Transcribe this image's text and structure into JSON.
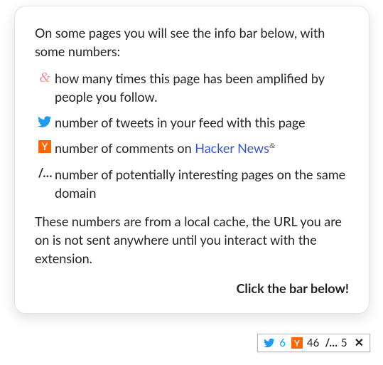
{
  "card": {
    "intro": "On some pages you will see the info bar below, with some numbers:",
    "legend": {
      "amp": "how many times this page has been amplified by people you follow.",
      "tweets": "number of tweets in your feed with this page",
      "hn_prefix": "number of comments on ",
      "hn_link": "Hacker News",
      "hn_sup": "&",
      "domain": "number of potentially interesting pages on the same domain"
    },
    "footer": "These numbers are from a local cache, the URL you are on is not sent anywhere until you interact with the extension.",
    "cta": "Click the bar below!"
  },
  "icons": {
    "amp": "&",
    "yc": "Y",
    "domain": "/…"
  },
  "bar": {
    "tweets": "6",
    "hn": "46",
    "domain": "5"
  },
  "colors": {
    "twitter": "#1d9bf0",
    "yc": "#ff6600",
    "link": "#3355cc"
  }
}
